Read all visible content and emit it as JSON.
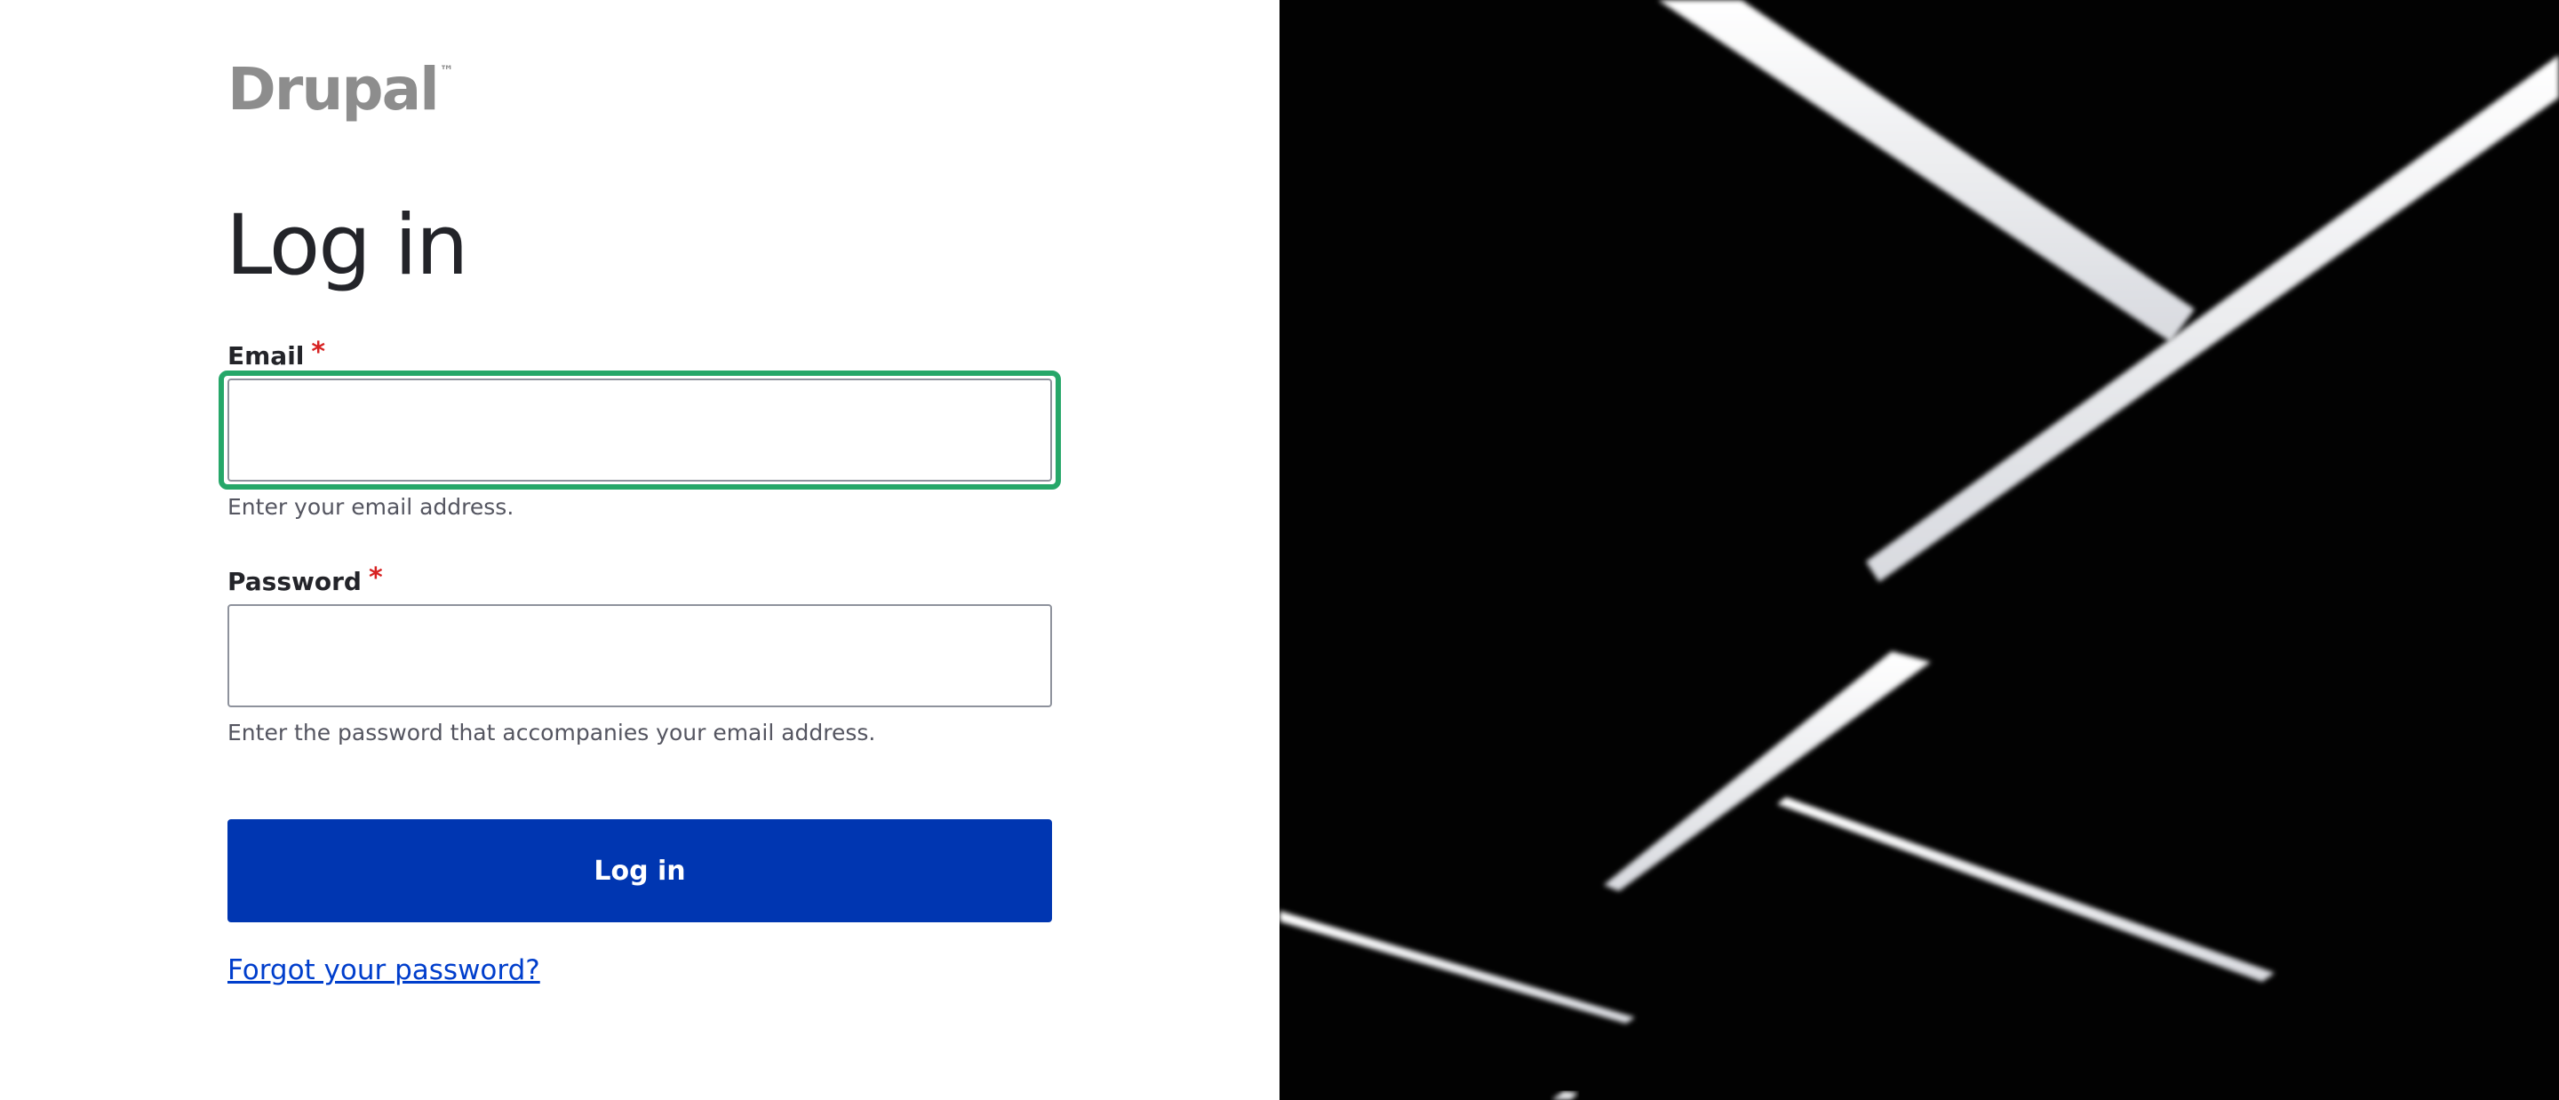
{
  "logo": {
    "text": "Drupal",
    "trademark": "™"
  },
  "page_title": "Log in",
  "form": {
    "email": {
      "label": "Email",
      "required_marker": "*",
      "value": "",
      "description": "Enter your email address."
    },
    "password": {
      "label": "Password",
      "required_marker": "*",
      "value": "",
      "description": "Enter the password that accompanies your email address."
    },
    "submit_label": "Log in",
    "forgot_link": "Forgot your password?"
  },
  "colors": {
    "primary_button": "#0036b1",
    "focus_ring": "#26a769",
    "required_star": "#d72222",
    "link": "#003ecc",
    "hero_background": "#000000"
  }
}
